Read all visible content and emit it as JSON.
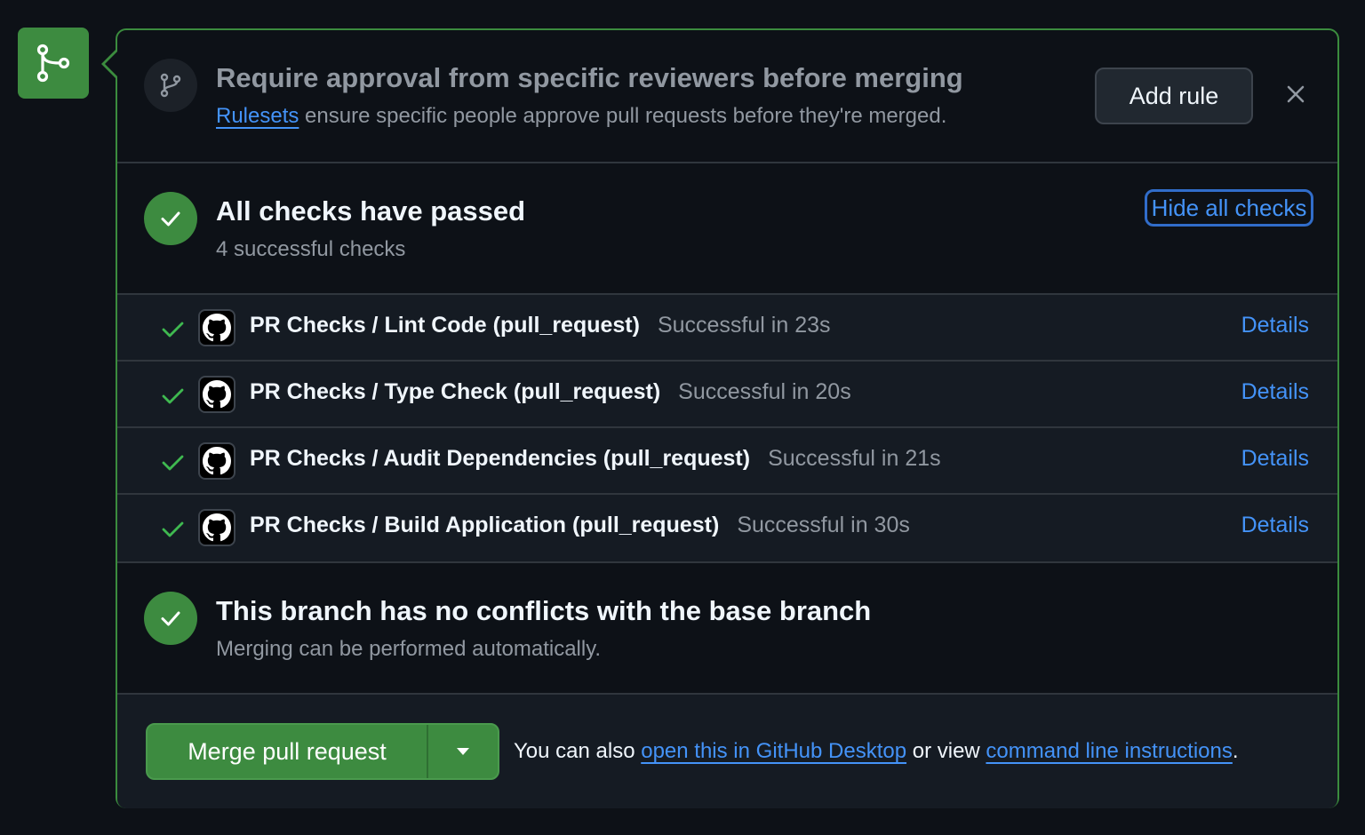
{
  "rule_banner": {
    "title": "Require approval from specific reviewers before merging",
    "link_text": "Rulesets",
    "description_rest": " ensure specific people approve pull requests before they're merged.",
    "add_rule_label": "Add rule"
  },
  "checks": {
    "title": "All checks have passed",
    "subtitle": "4 successful checks",
    "toggle_label": "Hide all checks",
    "items": [
      {
        "name": "PR Checks / Lint Code (pull_request)",
        "status": "Successful in 23s",
        "details": "Details"
      },
      {
        "name": "PR Checks / Type Check (pull_request)",
        "status": "Successful in 20s",
        "details": "Details"
      },
      {
        "name": "PR Checks / Audit Dependencies (pull_request)",
        "status": "Successful in 21s",
        "details": "Details"
      },
      {
        "name": "PR Checks / Build Application (pull_request)",
        "status": "Successful in 30s",
        "details": "Details"
      }
    ]
  },
  "conflicts": {
    "title": "This branch has no conflicts with the base branch",
    "subtitle": "Merging can be performed automatically."
  },
  "merge": {
    "button_label": "Merge pull request",
    "note_prefix": "You can also ",
    "desktop_link": "open this in GitHub Desktop",
    "note_middle": " or view ",
    "cli_link": "command line instructions",
    "note_suffix": "."
  },
  "colors": {
    "success": "#3d8b40",
    "link": "#4493f8",
    "muted": "#9198a1",
    "background": "#0d1117"
  },
  "icons": {
    "merge": "git-merge-icon",
    "branch": "git-branch-icon",
    "check": "check-icon",
    "close": "x-icon",
    "github": "github-mark-icon",
    "dropdown": "triangle-down-icon"
  }
}
